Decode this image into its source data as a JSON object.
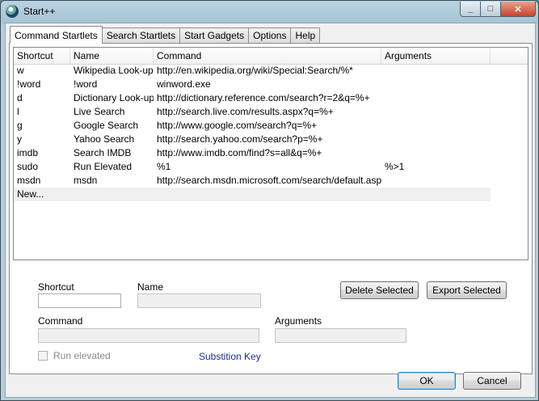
{
  "window": {
    "title": "Start++",
    "minimize": "_",
    "maximize": "□",
    "close": "✕"
  },
  "tabs": [
    {
      "label": "Command Startlets",
      "active": true
    },
    {
      "label": "Search Startlets"
    },
    {
      "label": "Start Gadgets"
    },
    {
      "label": "Options"
    },
    {
      "label": "Help"
    }
  ],
  "table": {
    "columns": [
      "Shortcut",
      "Name",
      "Command",
      "Arguments"
    ],
    "rows": [
      [
        "w",
        "Wikipedia Look-up",
        "http://en.wikipedia.org/wiki/Special:Search/%*",
        ""
      ],
      [
        "!word",
        "!word",
        "winword.exe",
        ""
      ],
      [
        "d",
        "Dictionary Look-up",
        "http://dictionary.reference.com/search?r=2&q=%+",
        ""
      ],
      [
        "l",
        "Live Search",
        "http://search.live.com/results.aspx?q=%+",
        ""
      ],
      [
        "g",
        "Google Search",
        "http://www.google.com/search?q=%+",
        ""
      ],
      [
        "y",
        "Yahoo Search",
        "http://search.yahoo.com/search?p=%+",
        ""
      ],
      [
        "imdb",
        "Search IMDB",
        "http://www.imdb.com/find?s=all&q=%+",
        ""
      ],
      [
        "sudo",
        "Run Elevated",
        "%1",
        "%>1"
      ],
      [
        "msdn",
        "msdn",
        "http://search.msdn.microsoft.com/search/default.aspx...",
        ""
      ]
    ],
    "new_row_label": "New..."
  },
  "form": {
    "shortcut_label": "Shortcut",
    "shortcut_value": "",
    "name_label": "Name",
    "name_value": "",
    "command_label": "Command",
    "command_value": "",
    "arguments_label": "Arguments",
    "arguments_value": "",
    "run_elevated_label": "Run elevated",
    "run_elevated_checked": false,
    "substitution_key_link": "Substition Key",
    "delete_selected": "Delete Selected",
    "export_selected": "Export Selected"
  },
  "footer": {
    "ok": "OK",
    "cancel": "Cancel"
  }
}
